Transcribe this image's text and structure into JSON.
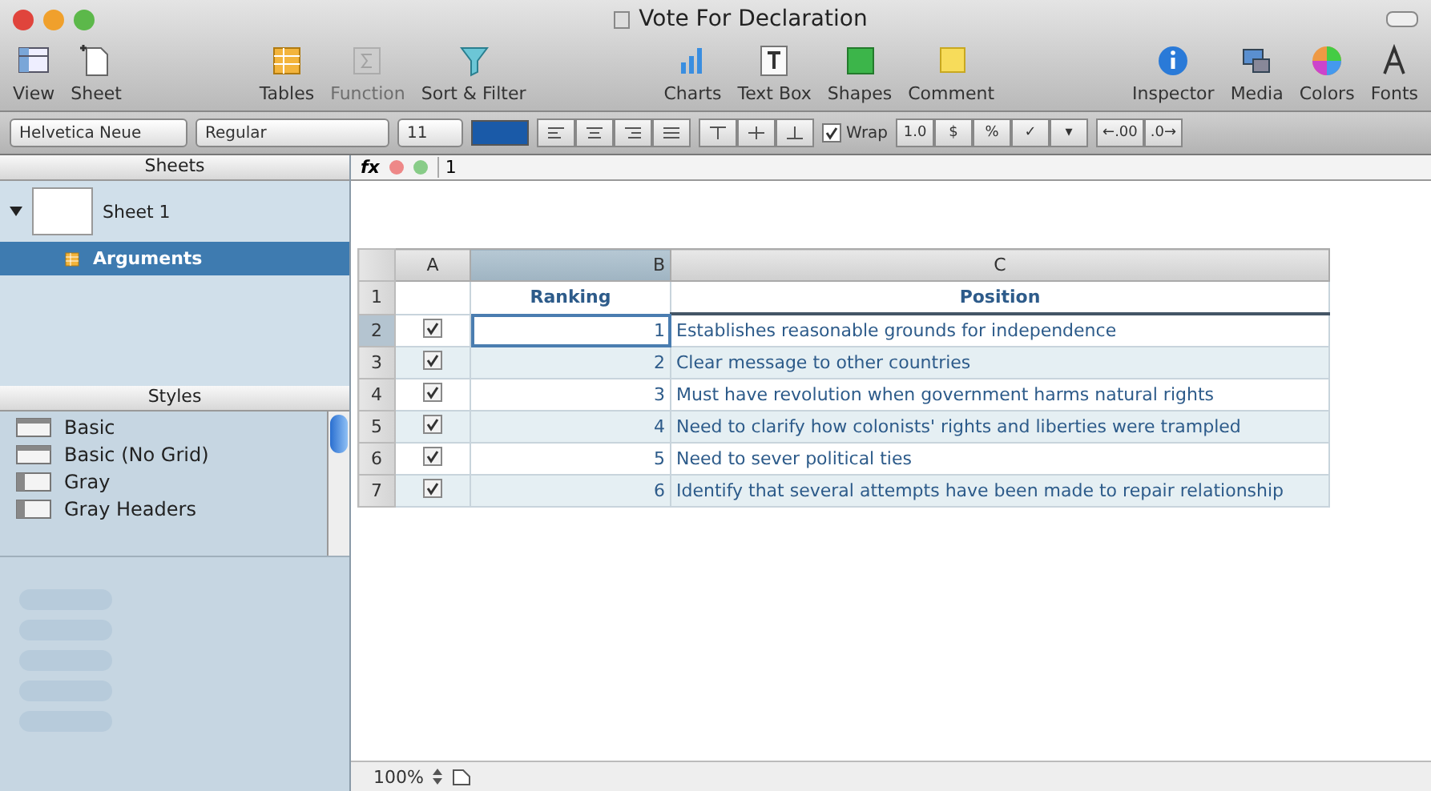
{
  "window": {
    "title": "Vote For Declaration"
  },
  "toolbar": {
    "items": [
      {
        "kind": "view",
        "label": "View",
        "disabled": false
      },
      {
        "kind": "sheet",
        "label": "Sheet",
        "disabled": false
      },
      {
        "kind": "gap"
      },
      {
        "kind": "tables",
        "label": "Tables",
        "disabled": false
      },
      {
        "kind": "function",
        "label": "Function",
        "disabled": true
      },
      {
        "kind": "filter",
        "label": "Sort & Filter",
        "disabled": false
      },
      {
        "kind": "gap"
      },
      {
        "kind": "charts",
        "label": "Charts",
        "disabled": false
      },
      {
        "kind": "textbox",
        "label": "Text Box",
        "disabled": false
      },
      {
        "kind": "shapes",
        "label": "Shapes",
        "disabled": false
      },
      {
        "kind": "comment",
        "label": "Comment",
        "disabled": false
      },
      {
        "kind": "gap"
      },
      {
        "kind": "inspector",
        "label": "Inspector",
        "disabled": false
      },
      {
        "kind": "media",
        "label": "Media",
        "disabled": false
      },
      {
        "kind": "colors",
        "label": "Colors",
        "disabled": false
      },
      {
        "kind": "fonts",
        "label": "Fonts",
        "disabled": false
      }
    ]
  },
  "format_bar": {
    "font": "Helvetica Neue",
    "style": "Regular",
    "size": "11",
    "wrap": {
      "label": "Wrap",
      "checked": true
    },
    "number_buttons": [
      "1.0",
      "$",
      "%",
      "✓",
      "▾"
    ],
    "decimal_buttons": [
      "←.00",
      ".0→"
    ]
  },
  "sidebar": {
    "sheets_header": "Sheets",
    "sheets": [
      {
        "label": "Sheet 1",
        "expanded": true,
        "selected": false,
        "children": [
          {
            "label": "Arguments",
            "selected": true
          }
        ]
      }
    ],
    "styles_header": "Styles",
    "styles": [
      "Basic",
      "Basic (No Grid)",
      "Gray",
      "Gray Headers"
    ]
  },
  "formula_bar": {
    "function_label": "fx",
    "value": "1"
  },
  "table": {
    "columns": [
      {
        "label": "A",
        "selected": false
      },
      {
        "label": "B",
        "selected": true
      },
      {
        "label": "C",
        "selected": false
      }
    ],
    "header_row": {
      "number": "1",
      "column_b": "Ranking",
      "column_c": "Position"
    },
    "rows": [
      {
        "number": "2",
        "selected": true,
        "checked": true,
        "ranking": "1",
        "position": "Establishes reasonable grounds for independence"
      },
      {
        "number": "3",
        "selected": false,
        "checked": true,
        "ranking": "2",
        "position": "Clear message to other countries"
      },
      {
        "number": "4",
        "selected": false,
        "checked": true,
        "ranking": "3",
        "position": "Must have revolution when government harms natural rights"
      },
      {
        "number": "5",
        "selected": false,
        "checked": true,
        "ranking": "4",
        "position": "Need to clarify how colonists' rights and liberties were trampled"
      },
      {
        "number": "6",
        "selected": false,
        "checked": true,
        "ranking": "5",
        "position": "Need to sever political ties"
      },
      {
        "number": "7",
        "selected": false,
        "checked": true,
        "ranking": "6",
        "position": "Identify that several attempts have been made to repair relationship"
      }
    ]
  },
  "status_bar": {
    "zoom": "100%"
  }
}
